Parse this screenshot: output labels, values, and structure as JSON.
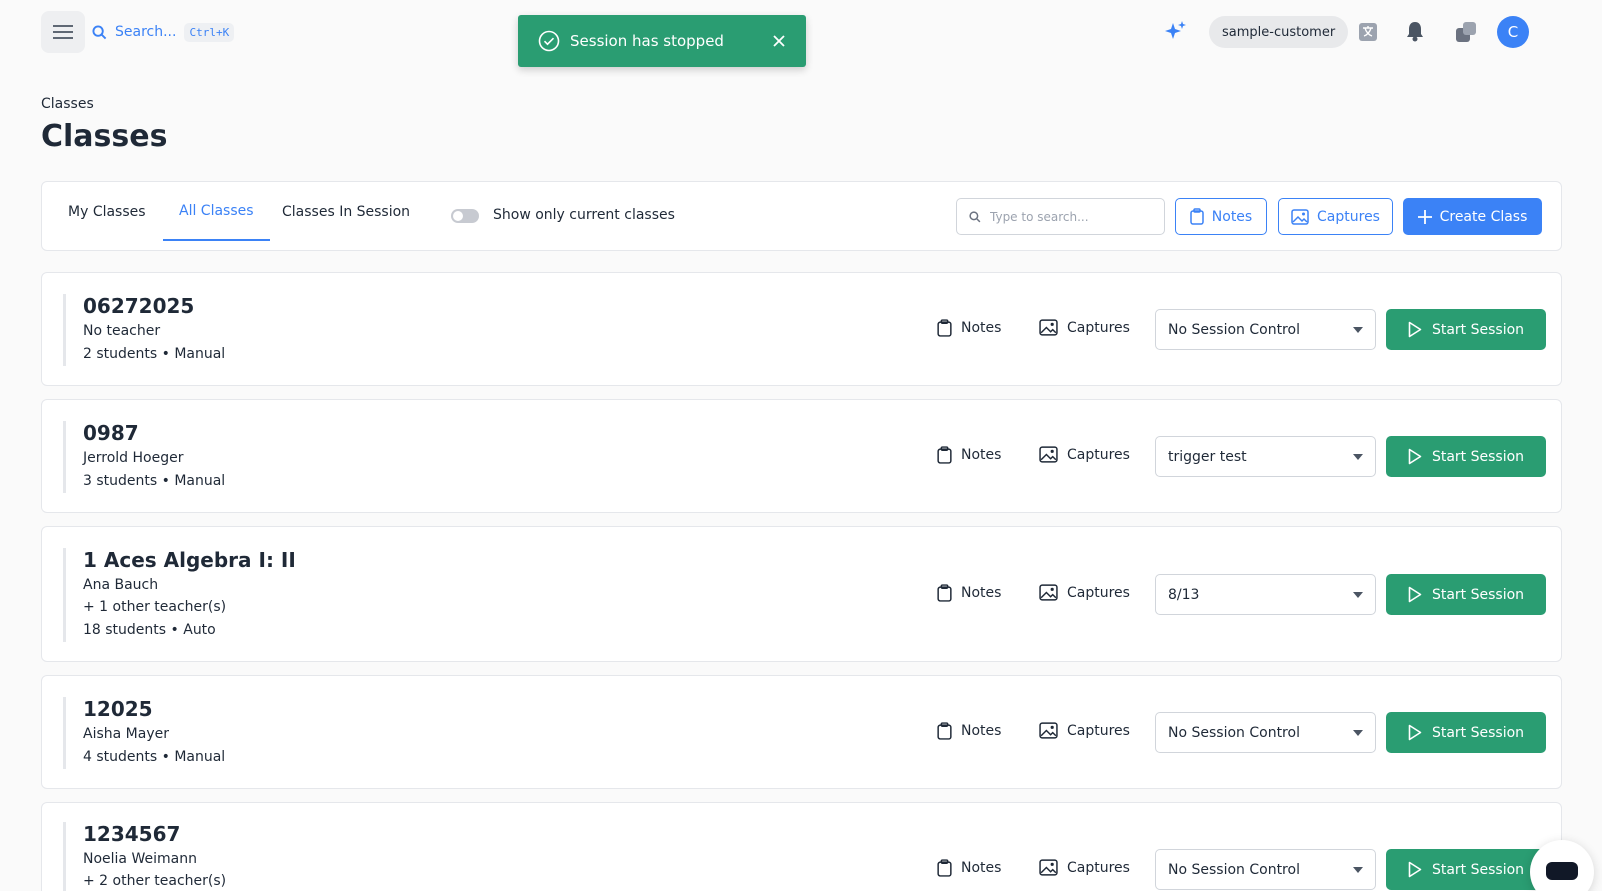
{
  "topbar": {
    "search_label": "Search...",
    "search_shortcut": "Ctrl+K",
    "customer": "sample-customer",
    "avatar_initial": "C",
    "icons": [
      "menu-icon",
      "search-icon",
      "sparkle-icon",
      "translate-icon",
      "bell-icon",
      "switch-app-icon"
    ]
  },
  "toast": {
    "message": "Session has stopped",
    "color": "#2a9d72"
  },
  "header": {
    "breadcrumb": "Classes",
    "title": "Classes"
  },
  "toolbar": {
    "tabs": [
      {
        "label": "My Classes",
        "active": false
      },
      {
        "label": "All Classes",
        "active": true
      },
      {
        "label": "Classes In Session",
        "active": false
      }
    ],
    "toggle_label": "Show only current classes",
    "toggle_on": false,
    "search_placeholder": "Type to search...",
    "notes_label": "Notes",
    "captures_label": "Captures",
    "create_label": "Create Class"
  },
  "card_actions": {
    "notes": "Notes",
    "captures": "Captures",
    "start": "Start Session"
  },
  "classes": [
    {
      "name": "06272025",
      "lines": [
        "No teacher",
        "2 students • Manual"
      ],
      "session_control": "No Session Control"
    },
    {
      "name": "0987",
      "lines": [
        "Jerrold Hoeger",
        "3 students • Manual"
      ],
      "session_control": "trigger test"
    },
    {
      "name": "1 Aces Algebra I: II",
      "lines": [
        "Ana Bauch",
        "+ 1 other teacher(s)",
        "18 students • Auto"
      ],
      "session_control": "8/13"
    },
    {
      "name": "12025",
      "lines": [
        "Aisha Mayer",
        "4 students • Manual"
      ],
      "session_control": "No Session Control"
    },
    {
      "name": "1234567",
      "lines": [
        "Noelia Weimann",
        "+ 2 other teacher(s)"
      ],
      "session_control": "No Session Control"
    }
  ],
  "colors": {
    "accent": "#3b82f6",
    "success": "#2a9d72"
  }
}
